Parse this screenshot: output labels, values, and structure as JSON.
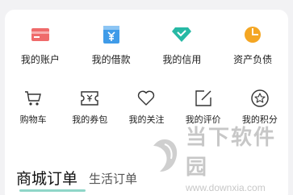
{
  "colors": {
    "account": "#ef6b6b",
    "loan": "#3f9be8",
    "credit": "#27b9a5",
    "assets": "#f4a623",
    "line_icon": "#333333"
  },
  "finance_row": [
    {
      "label": "我的账户",
      "icon": "card-icon"
    },
    {
      "label": "我的借款",
      "icon": "yen-box-icon"
    },
    {
      "label": "我的信用",
      "icon": "diamond-check-icon"
    },
    {
      "label": "资产负债",
      "icon": "pie-chart-icon"
    }
  ],
  "service_row": [
    {
      "label": "购物车",
      "icon": "cart-icon"
    },
    {
      "label": "我的券包",
      "icon": "coupon-icon"
    },
    {
      "label": "我的关注",
      "icon": "heart-icon"
    },
    {
      "label": "我的评价",
      "icon": "edit-icon"
    },
    {
      "label": "我的积分",
      "icon": "star-circle-icon"
    }
  ],
  "tabs": {
    "active": "商城订单",
    "inactive": "生活订单"
  },
  "watermark": {
    "title": "当下软件园",
    "url": "www.downxia.com"
  }
}
